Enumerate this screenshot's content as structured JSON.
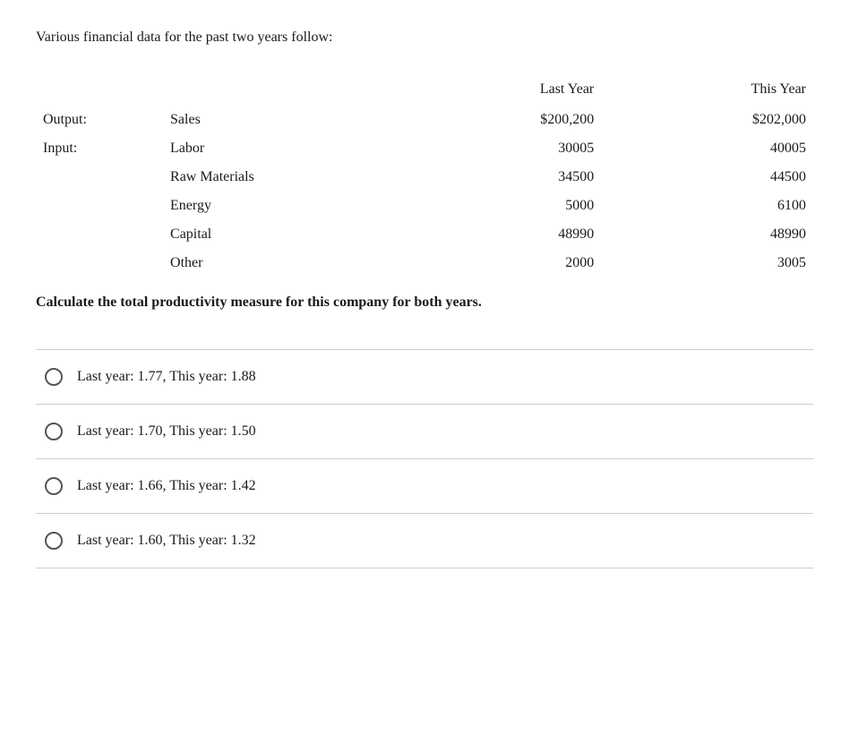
{
  "intro": {
    "text": "Various financial data for the past two years follow:"
  },
  "table": {
    "headers": {
      "last_year": "Last Year",
      "this_year": "This Year"
    },
    "rows": [
      {
        "label1": "Output:",
        "label2": "Sales",
        "last_year": "$200,200",
        "this_year": "$202,000"
      },
      {
        "label1": "Input:",
        "label2": "Labor",
        "last_year": "30005",
        "this_year": "40005"
      },
      {
        "label1": "",
        "label2": "Raw Materials",
        "last_year": "34500",
        "this_year": "44500"
      },
      {
        "label1": "",
        "label2": "Energy",
        "last_year": "5000",
        "this_year": "6100"
      },
      {
        "label1": "",
        "label2": "Capital",
        "last_year": "48990",
        "this_year": "48990"
      },
      {
        "label1": "",
        "label2": "Other",
        "last_year": "2000",
        "this_year": "3005"
      }
    ]
  },
  "calculate_text": "Calculate the total productivity measure for this company for both years.",
  "options": [
    {
      "label": "Last year: 1.77, This year: 1.88",
      "selected": false
    },
    {
      "label": "Last year: 1.70, This year: 1.50",
      "selected": false
    },
    {
      "label": "Last year: 1.66, This year: 1.42",
      "selected": false
    },
    {
      "label": "Last year: 1.60, This year: 1.32",
      "selected": false
    }
  ]
}
